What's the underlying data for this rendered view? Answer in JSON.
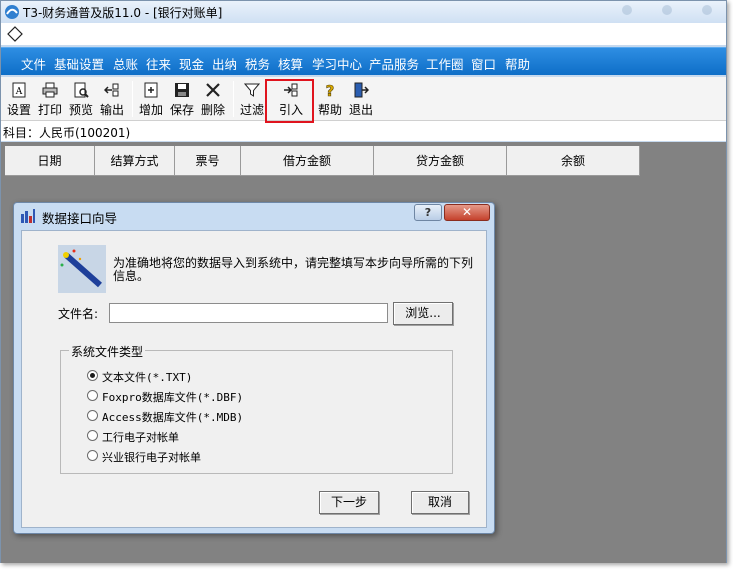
{
  "window": {
    "title": "T3-财务通普及版11.0 - [银行对账单]"
  },
  "menubar": {
    "items": [
      "文件",
      "基础设置",
      "总账",
      "往来",
      "现金",
      "出纳",
      "税务",
      "核算",
      "学习中心",
      "产品服务",
      "工作圈",
      "窗口",
      "帮助"
    ]
  },
  "toolbar": {
    "buttons": [
      {
        "label": "设置",
        "icon": "document-setup-icon"
      },
      {
        "label": "打印",
        "icon": "printer-icon"
      },
      {
        "label": "预览",
        "icon": "preview-icon"
      },
      {
        "label": "输出",
        "icon": "export-icon"
      },
      {
        "label": "增加",
        "icon": "add-icon"
      },
      {
        "label": "保存",
        "icon": "save-icon"
      },
      {
        "label": "删除",
        "icon": "delete-icon"
      },
      {
        "label": "过滤",
        "icon": "filter-icon"
      },
      {
        "label": "引入",
        "icon": "import-icon"
      },
      {
        "label": "帮助",
        "icon": "help-icon"
      },
      {
        "label": "退出",
        "icon": "exit-icon"
      }
    ]
  },
  "subject": {
    "text": "科目：人民币(100201)"
  },
  "grid": {
    "columns": [
      "日期",
      "结算方式",
      "票号",
      "借方金额",
      "贷方金额",
      "余额"
    ]
  },
  "dialog": {
    "title": "数据接口向导",
    "help_button": "?",
    "close_button": "✕",
    "description": "为准确地将您的数据导入到系统中，请完整填写本步向导所需的下列信息。",
    "file_label": "文件名:",
    "file_value": "",
    "browse_button": "浏览...",
    "filetype_legend": "系统文件类型",
    "filetypes": [
      {
        "label": "文本文件(*.TXT)",
        "selected": true
      },
      {
        "label": "Foxpro数据库文件(*.DBF)",
        "selected": false
      },
      {
        "label": "Access数据库文件(*.MDB)",
        "selected": false
      },
      {
        "label": "工行电子对帐单",
        "selected": false
      },
      {
        "label": "兴业银行电子对帐单",
        "selected": false
      }
    ],
    "next_button": "下一步",
    "cancel_button": "取消"
  },
  "colors": {
    "menubar": "#1a7dd6",
    "grid_background": "#828282",
    "highlight_box": "#e0141e",
    "dialog_frame": "#c8dcf2"
  }
}
